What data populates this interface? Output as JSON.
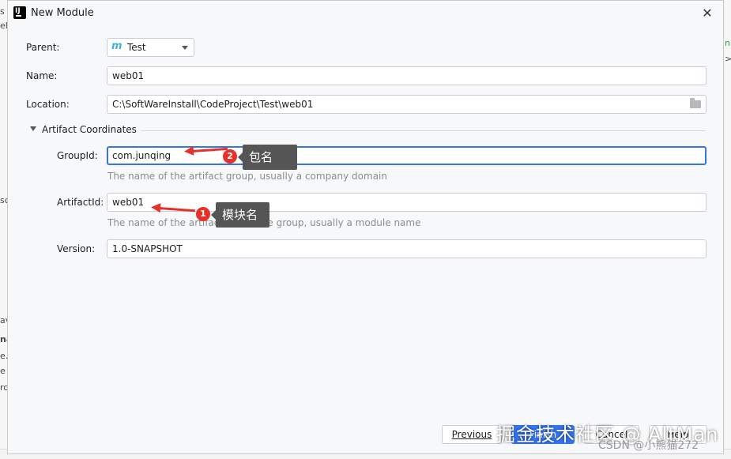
{
  "background": {
    "left_fragments": [
      "s",
      "el",
      "sc",
      "av",
      "na",
      "e.r",
      "e",
      "ro"
    ],
    "right_fragments": [
      "n",
      ">"
    ]
  },
  "dialog": {
    "title": "New Module",
    "parent": {
      "label": "Parent:",
      "value": "Test",
      "icon": "maven-module-icon"
    },
    "name": {
      "label": "Name:",
      "value": "web01"
    },
    "location": {
      "label": "Location:",
      "value": "C:\\SoftWareInstall\\CodeProject\\Test\\web01"
    },
    "section": {
      "title": "Artifact Coordinates"
    },
    "group_id": {
      "label": "GroupId:",
      "value": "com.junqing",
      "hint": "The name of the artifact group, usually a company domain"
    },
    "artifact_id": {
      "label": "ArtifactId:",
      "value": "web01",
      "hint": "The name of the artifact within the group, usually a module name"
    },
    "version": {
      "label": "Version:",
      "value": "1.0-SNAPSHOT"
    },
    "buttons": {
      "previous": "Previous",
      "finish": "Finish",
      "cancel": "Cancel",
      "help": "Help"
    }
  },
  "annotations": [
    {
      "number": "1",
      "text": "模块名"
    },
    {
      "number": "2",
      "text": "包名"
    }
  ],
  "watermark": {
    "main": "掘金技术社区 @ AltMan",
    "sub": "CSDN @小熊猫272"
  },
  "colors": {
    "accent": "#3574f0",
    "annotation_red": "#e8302a",
    "callout_bg": "#555555"
  }
}
